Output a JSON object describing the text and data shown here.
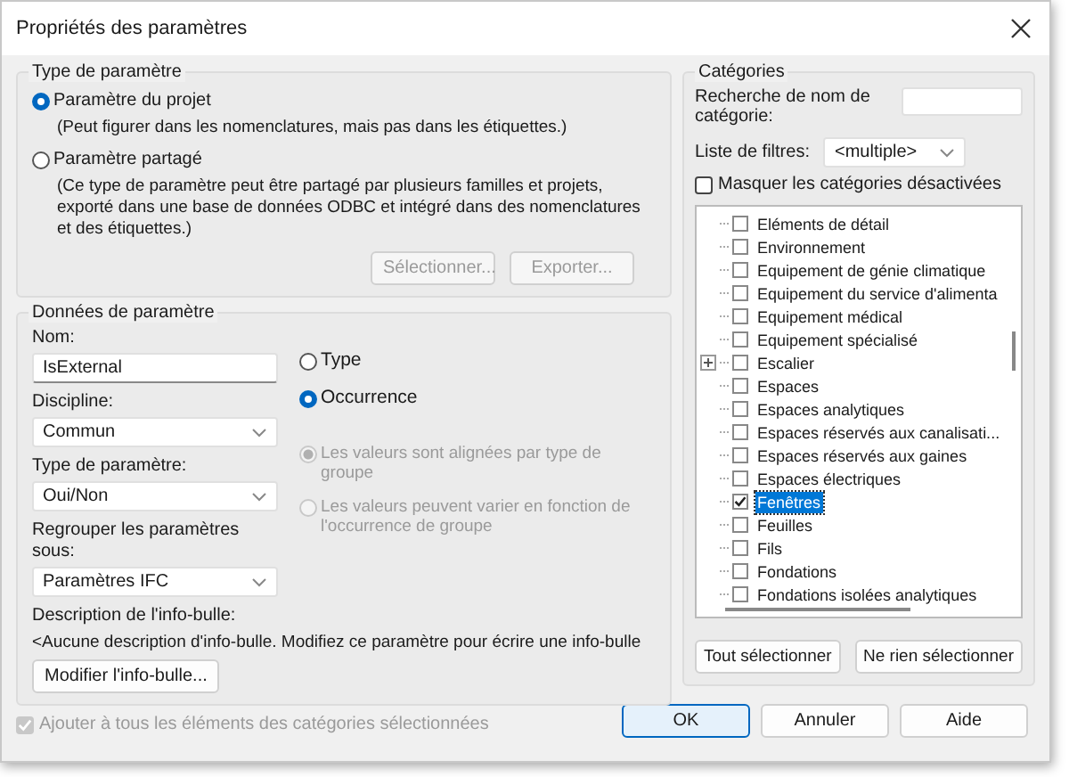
{
  "window": {
    "title": "Propriétés des paramètres"
  },
  "parameter_type": {
    "legend": "Type de paramètre",
    "options": [
      {
        "label": "Paramètre du projet",
        "description": "(Peut figurer dans les nomenclatures, mais pas dans les étiquettes.)",
        "selected": true
      },
      {
        "label": "Paramètre partagé",
        "description": "(Ce type de paramètre peut être partagé par plusieurs familles et projets, exporté dans une base de données ODBC et intégré dans des nomenclatures et des étiquettes.)",
        "selected": false
      }
    ],
    "buttons": [
      {
        "label": "Sélectionner...",
        "disabled": true
      },
      {
        "label": "Exporter...",
        "disabled": true
      }
    ]
  },
  "parameter_data": {
    "legend": "Données de paramètre",
    "fields": [
      {
        "label": "Nom:",
        "value": "IsExternal",
        "kind": "text"
      },
      {
        "label": "Discipline:",
        "value": "Commun",
        "kind": "select"
      },
      {
        "label": "Type de paramètre:",
        "value": "Oui/Non",
        "kind": "select"
      },
      {
        "label": "Regrouper les paramètres sous:",
        "value": "Paramètres IFC",
        "kind": "select"
      }
    ],
    "scope_options": [
      {
        "label": "Type",
        "selected": false
      },
      {
        "label": "Occurrence",
        "selected": true
      }
    ],
    "group_options": [
      {
        "label": "Les valeurs sont alignées par type de groupe",
        "selected": true,
        "disabled": true
      },
      {
        "label": "Les valeurs peuvent varier en fonction de l'occurrence de groupe",
        "selected": false,
        "disabled": true
      }
    ],
    "tooltip": {
      "label": "Description de l'info-bulle:",
      "text": "<Aucune description d'info-bulle. Modifiez ce paramètre pour écrire une info-bulle"
    },
    "edit_button": "Modifier l'info-bulle..."
  },
  "add_all": {
    "label": "Ajouter à tous les éléments des catégories sélectionnées",
    "checked": true,
    "disabled": true
  },
  "categories": {
    "legend": "Catégories",
    "search_label": "Recherche de nom de catégorie:",
    "filter_label": "Liste de filtres:",
    "filter_value": "<multiple>",
    "hide_disabled": {
      "label": "Masquer les catégories désactivées",
      "checked": false
    },
    "items": [
      {
        "label": "Eléments de détail",
        "checked": false,
        "selected": false,
        "expandable": false
      },
      {
        "label": "Environnement",
        "checked": false,
        "selected": false,
        "expandable": false
      },
      {
        "label": "Equipement de génie climatique",
        "checked": false,
        "selected": false,
        "expandable": false
      },
      {
        "label": "Equipement du service d'alimenta",
        "checked": false,
        "selected": false,
        "expandable": false
      },
      {
        "label": "Equipement médical",
        "checked": false,
        "selected": false,
        "expandable": false
      },
      {
        "label": "Equipement spécialisé",
        "checked": false,
        "selected": false,
        "expandable": false
      },
      {
        "label": "Escalier",
        "checked": false,
        "selected": false,
        "expandable": true
      },
      {
        "label": "Espaces",
        "checked": false,
        "selected": false,
        "expandable": false
      },
      {
        "label": "Espaces analytiques",
        "checked": false,
        "selected": false,
        "expandable": false
      },
      {
        "label": "Espaces réservés aux canalisati...",
        "checked": false,
        "selected": false,
        "expandable": false
      },
      {
        "label": "Espaces réservés aux gaines",
        "checked": false,
        "selected": false,
        "expandable": false
      },
      {
        "label": "Espaces électriques",
        "checked": false,
        "selected": false,
        "expandable": false
      },
      {
        "label": "Fenêtres",
        "checked": true,
        "selected": true,
        "expandable": false
      },
      {
        "label": "Feuilles",
        "checked": false,
        "selected": false,
        "expandable": false
      },
      {
        "label": "Fils",
        "checked": false,
        "selected": false,
        "expandable": false
      },
      {
        "label": "Fondations",
        "checked": false,
        "selected": false,
        "expandable": false
      },
      {
        "label": "Fondations isolées analytiques",
        "checked": false,
        "selected": false,
        "expandable": false
      }
    ],
    "buttons": [
      "Tout sélectionner",
      "Ne rien sélectionner"
    ]
  },
  "buttons": [
    {
      "label": "OK",
      "default": true
    },
    {
      "label": "Annuler",
      "default": false
    },
    {
      "label": "Aide",
      "default": false
    }
  ]
}
